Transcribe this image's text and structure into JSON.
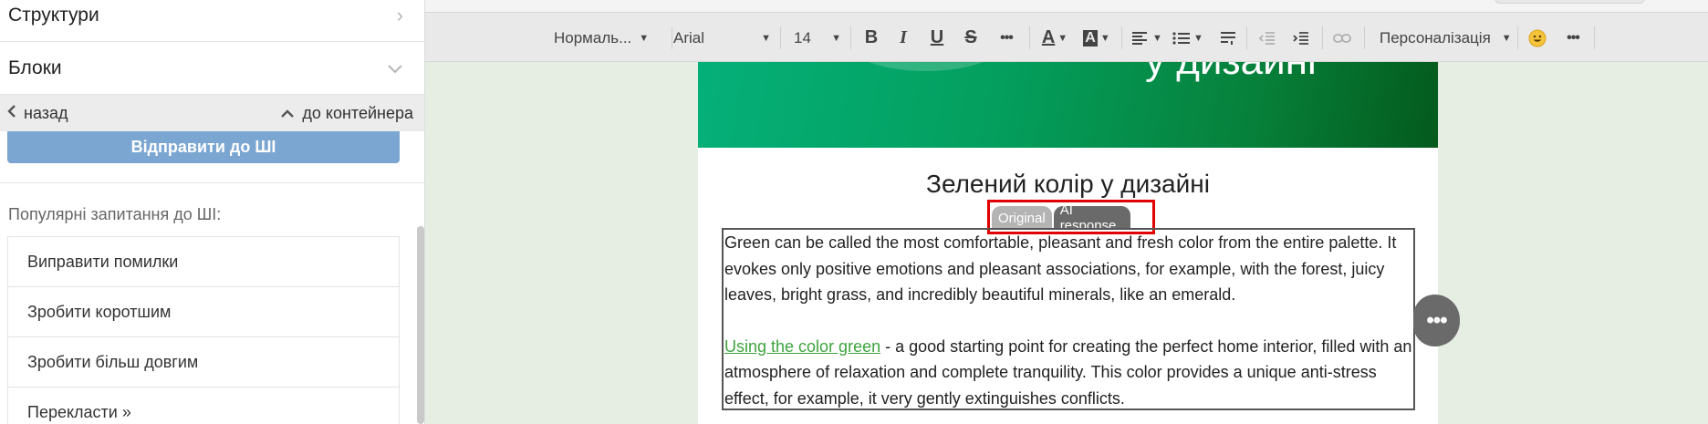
{
  "sidebar": {
    "sections": [
      {
        "label": "Структури",
        "icon": "chevron-right-icon"
      },
      {
        "label": "Блоки",
        "icon": "chevron-down-icon"
      }
    ],
    "nav": {
      "back_label": "назад",
      "to_container_label": "до контейнера"
    },
    "send_button_label": "Відправити до ШІ",
    "popular_title": "Популярні запитання до ШІ:",
    "popular_items": [
      "Виправити помилки",
      "Зробити коротшим",
      "Зробити більш довгим",
      "Перекласти »"
    ]
  },
  "toolbar": {
    "paragraph_style": "Нормаль...",
    "font_family": "Arial",
    "font_size": "14",
    "bold": "B",
    "italic": "I",
    "underline": "U",
    "strike": "S",
    "more": "•••",
    "font_color": "A",
    "bg_color": "A",
    "personalization_label": "Персоналізація",
    "emoji": "😀",
    "more_right": "•••"
  },
  "email": {
    "heading": "Зелений колір у дизайні",
    "tabs": {
      "original": "Original",
      "ai_response": "AI response"
    },
    "paragraph1": "Green can be called the most comfortable, pleasant and fresh color from the entire palette. It evokes only positive emotions and pleasant associations, for example, with the forest, juicy leaves, bright grass, and incredibly beautiful minerals, like an emerald.",
    "link_text": "Using the color green",
    "paragraph2_rest": " - a good starting point for creating the perfect home interior, filled with an atmosphere of relaxation and complete tranquility. This color provides a unique anti-stress effect, for example, it very gently extinguishes conflicts."
  },
  "fab_label": "•••",
  "colors": {
    "accent_blue": "#7aa6d1",
    "banner_green": "#049f5e",
    "link_green": "#3ea33e",
    "highlight_red": "#e00000",
    "canvas_bg": "#e6eee3"
  }
}
